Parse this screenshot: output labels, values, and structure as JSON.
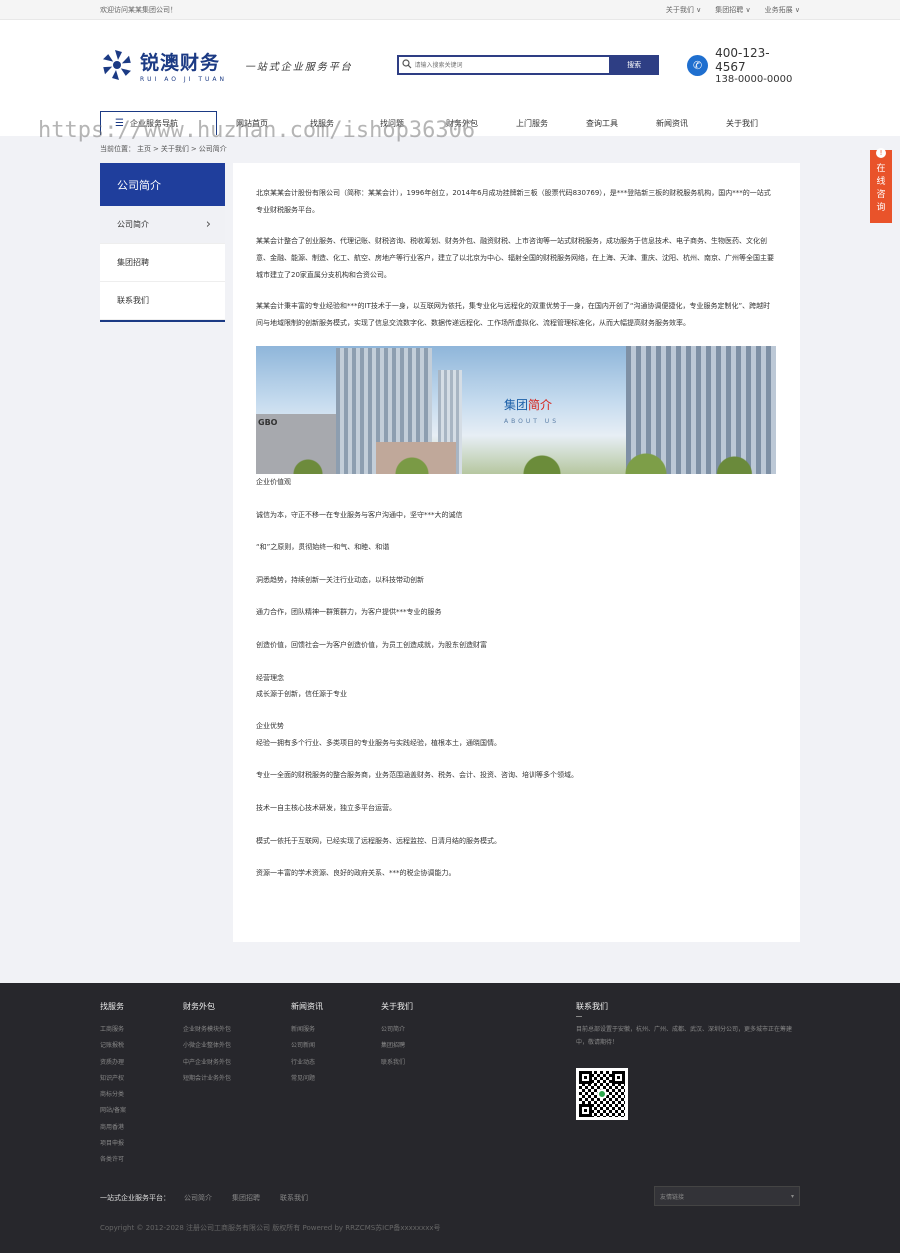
{
  "topbar": {
    "welcome": "欢迎访问某某集团公司！",
    "links": [
      "关于我们 ∨",
      "集团招聘 ∨",
      "业务拓展 ∨"
    ]
  },
  "header": {
    "logo_cn": "锐澳财务",
    "logo_en": "RUI AO JI TUAN",
    "slogan": "一站式企业服务平台",
    "search_placeholder": "请输入搜索关键词",
    "search_button": "搜索",
    "phone1": "400-123-4567",
    "phone2": "138-0000-0000"
  },
  "nav": {
    "all_label": "企业服务导航",
    "items": [
      "网站首页",
      "找服务",
      "找问题",
      "财务外包",
      "上门服务",
      "查询工具",
      "新闻资讯",
      "关于我们"
    ]
  },
  "watermark": "https://www.huzhan.com/ishop36306",
  "breadcrumb": {
    "prefix": "当前位置：",
    "items": [
      "主页",
      ">",
      "关于我们",
      ">",
      "公司简介"
    ]
  },
  "sidebar": {
    "title": "公司简介",
    "items": [
      "公司简介",
      "集团招聘",
      "联系我们"
    ],
    "active_arrow": "›"
  },
  "content": {
    "paragraphs": [
      "北京某某会计股份有限公司（简称：某某会计），1996年创立，2014年6月成功挂牌新三板（股票代码830769），是***登陆新三板的财税服务机构，国内***的一站式专业财税服务平台。",
      "某某会计整合了创业服务、代理记账、财税咨询、税收筹划、财务外包、融资财税、上市咨询等一站式财税服务，成功服务于信息技术、电子商务、生物医药、文化创意、金融、能源、制造、化工、航空、房地产等行业客户，建立了以北京为中心、辐射全国的财税服务网络，在上海、天津、重庆、沈阳、杭州、南京、广州等全国主要城市建立了20家直属分支机构和合资公司。",
      "某某会计秉丰富的专业经验和***的IT技术于一身，以互联网为依托，集专业化与远程化的双重优势于一身，在国内开创了“沟通协调便捷化，专业服务定制化”、跨越时间与地域限制的创新服务模式，实现了信息交流数字化、数据传递远程化、工作场所虚拟化、流程管理标准化，从而大幅提高财务服务效率。"
    ],
    "banner_title_a": "集团",
    "banner_title_b": "简介",
    "banner_sub": "ABOUT US",
    "banner_sign": "GBO",
    "lines": [
      "企业价值观",
      "",
      "诚信为本，守正不移一在专业服务与客户沟通中，坚守***大的诚信",
      "",
      "“和”之原则，贯彻始终一和气、和睦、和谐",
      "",
      "洞悉趋势，持续创新一关注行业动态，以科技带动创新",
      "",
      "通力合作，团队精神一群策群力，为客户提供***专业的服务",
      "",
      "创造价值，回馈社会一为客户创造价值，为员工创造成就，为股东创造财富",
      "",
      "经营理念",
      "成长源于创新，信任源于专业",
      "",
      "企业优势",
      "经验一拥有多个行业、多类项目的专业服务与实践经验，植根本土，通晓国情。",
      "",
      "专业一全面的财税服务的整合服务商，业务范围涵盖财务、税务、会计、投资、咨询、培训等多个领域。",
      "",
      "技术一自主核心技术研发，独立多平台运营。",
      "",
      "模式一依托于互联网，已经实现了远程服务、远程监控、日清月结的服务模式。",
      "",
      "资源一丰富的学术资源、良好的政府关系、***的税企协调能力。"
    ]
  },
  "float_service": {
    "label": [
      "在",
      "线",
      "咨",
      "询"
    ],
    "icon": "!"
  },
  "footer": {
    "columns": [
      {
        "title": "找服务",
        "links": [
          "工商服务",
          "记账报税",
          "资质办理",
          "知识产权",
          "商标分类",
          "网站/备案",
          "商用香港",
          "项目申报",
          "各类许可"
        ]
      },
      {
        "title": "财务外包",
        "links": [
          "企业财务模块外包",
          "小微企业整体外包",
          "中产企业财务外包",
          "短期会计业务外包"
        ]
      },
      {
        "title": "新闻资讯",
        "links": [
          "新闻服务",
          "公司新闻",
          "行业动态",
          "常见问题"
        ]
      },
      {
        "title": "关于我们",
        "links": [
          "公司简介",
          "集团招聘",
          "联系我们"
        ]
      }
    ],
    "contact_title": "联系我们",
    "contact_text": "目前总部设置于安徽，杭州、广州、成都、武汉、深圳分公司，更多城市正在筹建中，敬请期待！",
    "bottom_label": "一站式企业服务平台：",
    "bottom_links": [
      "公司简介",
      "集团招聘",
      "联系我们"
    ],
    "friendlinks": "友情链接",
    "friendlinks_arrow": "▾",
    "copyright": "Copyright © 2012-2028 注册公司工商服务有限公司 版权所有 Powered by RRZCMS苏ICP备xxxxxxxx号"
  },
  "icons": {
    "search": "search-icon",
    "menu": "menu-icon",
    "phone": "phone-icon",
    "chevron": "chevron-right-icon",
    "qr": "qr-code-icon"
  },
  "colors": {
    "brand": "#1b3a84",
    "sidebar_head": "#1f3e9c",
    "float": "#e9532a",
    "footer_bg": "#27272c"
  }
}
